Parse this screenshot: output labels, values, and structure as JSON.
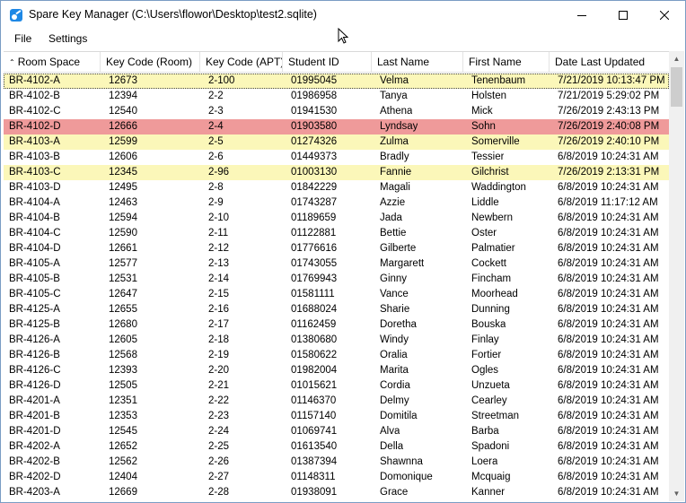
{
  "window": {
    "title": "Spare Key Manager (C:\\Users\\flowor\\Desktop\\test2.sqlite)",
    "icon": "app-key-icon",
    "controls": [
      "minimize-icon",
      "maximize-icon",
      "close-icon"
    ]
  },
  "menu": [
    {
      "label": "File"
    },
    {
      "label": "Settings"
    }
  ],
  "table": {
    "sort_indicator": "^",
    "columns": [
      "Room Space",
      "Key Code (Room)",
      "Key Code (APT)",
      "Student ID",
      "Last Name",
      "First Name",
      "Date Last Updated"
    ],
    "colors": {
      "yellow": "#fbf7b9",
      "red": "#ef9a9a"
    },
    "rows": [
      {
        "cells": [
          "BR-4102-A",
          "12673",
          "2-100",
          "01995045",
          "Velma",
          "Tenenbaum",
          "7/21/2019 10:13:47 PM"
        ],
        "highlight": "yellow",
        "selected": true
      },
      {
        "cells": [
          "BR-4102-B",
          "12394",
          "2-2",
          "01986958",
          "Tanya",
          "Holsten",
          "7/21/2019 5:29:02 PM"
        ],
        "highlight": ""
      },
      {
        "cells": [
          "BR-4102-C",
          "12540",
          "2-3",
          "01941530",
          "Athena",
          "Mick",
          "7/26/2019 2:43:13 PM"
        ],
        "highlight": ""
      },
      {
        "cells": [
          "BR-4102-D",
          "12666",
          "2-4",
          "01903580",
          "Lyndsay",
          "Sohn",
          "7/26/2019 2:40:08 PM"
        ],
        "highlight": "red"
      },
      {
        "cells": [
          "BR-4103-A",
          "12599",
          "2-5",
          "01274326",
          "Zulma",
          "Somerville",
          "7/26/2019 2:40:10 PM"
        ],
        "highlight": "yellow"
      },
      {
        "cells": [
          "BR-4103-B",
          "12606",
          "2-6",
          "01449373",
          "Bradly",
          "Tessier",
          "6/8/2019 10:24:31 AM"
        ],
        "highlight": ""
      },
      {
        "cells": [
          "BR-4103-C",
          "12345",
          "2-96",
          "01003130",
          "Fannie",
          "Gilchrist",
          "7/26/2019 2:13:31 PM"
        ],
        "highlight": "yellow"
      },
      {
        "cells": [
          "BR-4103-D",
          "12495",
          "2-8",
          "01842229",
          "Magali",
          "Waddington",
          "6/8/2019 10:24:31 AM"
        ],
        "highlight": ""
      },
      {
        "cells": [
          "BR-4104-A",
          "12463",
          "2-9",
          "01743287",
          "Azzie",
          "Liddle",
          "6/8/2019 11:17:12 AM"
        ],
        "highlight": ""
      },
      {
        "cells": [
          "BR-4104-B",
          "12594",
          "2-10",
          "01189659",
          "Jada",
          "Newbern",
          "6/8/2019 10:24:31 AM"
        ],
        "highlight": ""
      },
      {
        "cells": [
          "BR-4104-C",
          "12590",
          "2-11",
          "01122881",
          "Bettie",
          "Oster",
          "6/8/2019 10:24:31 AM"
        ],
        "highlight": ""
      },
      {
        "cells": [
          "BR-4104-D",
          "12661",
          "2-12",
          "01776616",
          "Gilberte",
          "Palmatier",
          "6/8/2019 10:24:31 AM"
        ],
        "highlight": ""
      },
      {
        "cells": [
          "BR-4105-A",
          "12577",
          "2-13",
          "01743055",
          "Margarett",
          "Cockett",
          "6/8/2019 10:24:31 AM"
        ],
        "highlight": ""
      },
      {
        "cells": [
          "BR-4105-B",
          "12531",
          "2-14",
          "01769943",
          "Ginny",
          "Fincham",
          "6/8/2019 10:24:31 AM"
        ],
        "highlight": ""
      },
      {
        "cells": [
          "BR-4105-C",
          "12647",
          "2-15",
          "01581111",
          "Vance",
          "Moorhead",
          "6/8/2019 10:24:31 AM"
        ],
        "highlight": ""
      },
      {
        "cells": [
          "BR-4125-A",
          "12655",
          "2-16",
          "01688024",
          "Sharie",
          "Dunning",
          "6/8/2019 10:24:31 AM"
        ],
        "highlight": ""
      },
      {
        "cells": [
          "BR-4125-B",
          "12680",
          "2-17",
          "01162459",
          "Doretha",
          "Bouska",
          "6/8/2019 10:24:31 AM"
        ],
        "highlight": ""
      },
      {
        "cells": [
          "BR-4126-A",
          "12605",
          "2-18",
          "01380680",
          "Windy",
          "Finlay",
          "6/8/2019 10:24:31 AM"
        ],
        "highlight": ""
      },
      {
        "cells": [
          "BR-4126-B",
          "12568",
          "2-19",
          "01580622",
          "Oralia",
          "Fortier",
          "6/8/2019 10:24:31 AM"
        ],
        "highlight": ""
      },
      {
        "cells": [
          "BR-4126-C",
          "12393",
          "2-20",
          "01982004",
          "Marita",
          "Ogles",
          "6/8/2019 10:24:31 AM"
        ],
        "highlight": ""
      },
      {
        "cells": [
          "BR-4126-D",
          "12505",
          "2-21",
          "01015621",
          "Cordia",
          "Unzueta",
          "6/8/2019 10:24:31 AM"
        ],
        "highlight": ""
      },
      {
        "cells": [
          "BR-4201-A",
          "12351",
          "2-22",
          "01146370",
          "Delmy",
          "Cearley",
          "6/8/2019 10:24:31 AM"
        ],
        "highlight": ""
      },
      {
        "cells": [
          "BR-4201-B",
          "12353",
          "2-23",
          "01157140",
          "Domitila",
          "Streetman",
          "6/8/2019 10:24:31 AM"
        ],
        "highlight": ""
      },
      {
        "cells": [
          "BR-4201-D",
          "12545",
          "2-24",
          "01069741",
          "Alva",
          "Barba",
          "6/8/2019 10:24:31 AM"
        ],
        "highlight": ""
      },
      {
        "cells": [
          "BR-4202-A",
          "12652",
          "2-25",
          "01613540",
          "Della",
          "Spadoni",
          "6/8/2019 10:24:31 AM"
        ],
        "highlight": ""
      },
      {
        "cells": [
          "BR-4202-B",
          "12562",
          "2-26",
          "01387394",
          "Shawnna",
          "Loera",
          "6/8/2019 10:24:31 AM"
        ],
        "highlight": ""
      },
      {
        "cells": [
          "BR-4202-D",
          "12404",
          "2-27",
          "01148311",
          "Domonique",
          "Mcquaig",
          "6/8/2019 10:24:31 AM"
        ],
        "highlight": ""
      },
      {
        "cells": [
          "BR-4203-A",
          "12669",
          "2-28",
          "01938091",
          "Grace",
          "Kanner",
          "6/8/2019 10:24:31 AM"
        ],
        "highlight": ""
      }
    ]
  },
  "scrollbar": {
    "up_arrow": "▲",
    "down_arrow": "▼"
  }
}
